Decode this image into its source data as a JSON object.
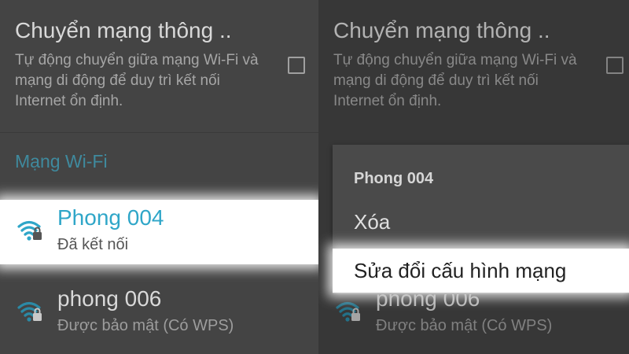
{
  "colors": {
    "background": "#444444",
    "accent": "#2fa6c8",
    "section_label": "#3f8a9e",
    "highlight": "#ffffff"
  },
  "left": {
    "smart_switch": {
      "title": "Chuyển mạng thông ..",
      "description": "Tự động chuyển giữa mạng Wi-Fi và mạng di động để duy trì kết nối Internet ổn định.",
      "checked": false
    },
    "section_label": "Mạng Wi-Fi",
    "networks": [
      {
        "name": "Phong 004",
        "status": "Đã kết nối",
        "icon": "wifi-lock-icon"
      },
      {
        "name": "phong 006",
        "status": "Được bảo mật (Có WPS)",
        "icon": "wifi-lock-icon"
      }
    ]
  },
  "right": {
    "smart_switch": {
      "title": "Chuyển mạng thông ..",
      "description": "Tự động chuyển giữa mạng Wi-Fi và mạng di động để duy trì kết nối Internet ổn định.",
      "checked": false
    },
    "background_network": {
      "name": "phong 006",
      "status": "Được bảo mật (Có WPS)",
      "icon": "wifi-lock-icon"
    },
    "dialog": {
      "title": "Phong 004",
      "items": [
        {
          "label": "Xóa"
        },
        {
          "label": "Sửa đổi cấu hình mạng"
        }
      ]
    }
  }
}
